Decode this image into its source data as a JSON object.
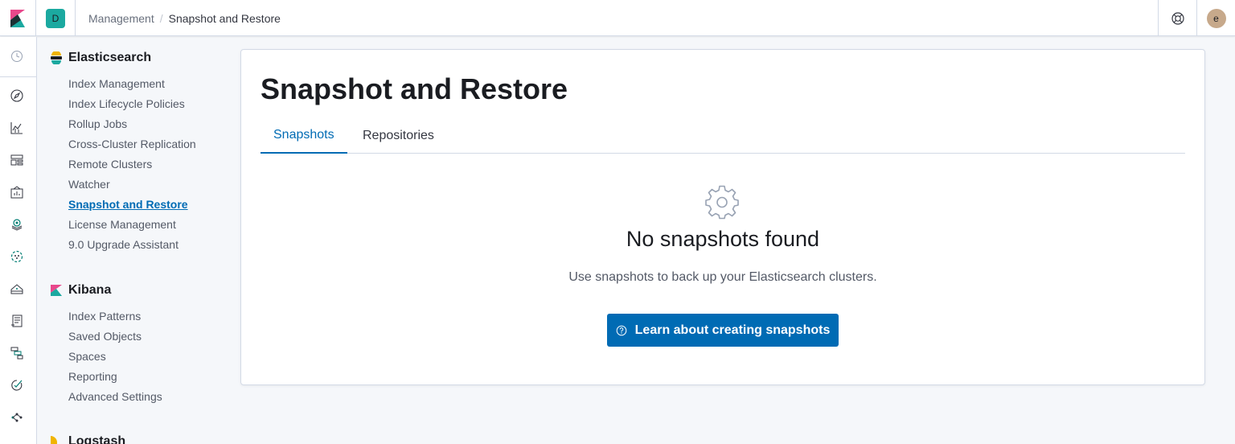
{
  "header": {
    "space_initial": "D",
    "breadcrumbs": [
      "Management",
      "Snapshot and Restore"
    ],
    "breadcrumb_separator": "/",
    "user_initial": "e"
  },
  "nav_rail": {
    "icons": [
      "recently-viewed-icon",
      "discover-icon",
      "visualize-icon",
      "dashboard-icon",
      "canvas-icon",
      "maps-icon",
      "ml-icon",
      "infrastructure-icon",
      "logs-icon",
      "apm-icon",
      "uptime-icon",
      "graph-icon"
    ]
  },
  "sidenav": {
    "groups": [
      {
        "title": "Elasticsearch",
        "items": [
          "Index Management",
          "Index Lifecycle Policies",
          "Rollup Jobs",
          "Cross-Cluster Replication",
          "Remote Clusters",
          "Watcher",
          "Snapshot and Restore",
          "License Management",
          "9.0 Upgrade Assistant"
        ]
      },
      {
        "title": "Kibana",
        "items": [
          "Index Patterns",
          "Saved Objects",
          "Spaces",
          "Reporting",
          "Advanced Settings"
        ]
      },
      {
        "title": "Logstash",
        "items": []
      }
    ],
    "active_item": "Snapshot and Restore"
  },
  "main": {
    "title": "Snapshot and Restore",
    "tabs": [
      {
        "label": "Snapshots",
        "selected": true
      },
      {
        "label": "Repositories",
        "selected": false
      }
    ],
    "empty_state": {
      "icon": "gear-icon",
      "title": "No snapshots found",
      "body": "Use snapshots to back up your Elasticsearch clusters.",
      "button_label": "Learn about creating snapshots",
      "button_icon": "help-icon"
    }
  },
  "colors": {
    "accent": "#006bb4",
    "space_avatar": "#1ba9a0",
    "user_avatar": "#c7a98b",
    "background": "#f5f7fa"
  }
}
